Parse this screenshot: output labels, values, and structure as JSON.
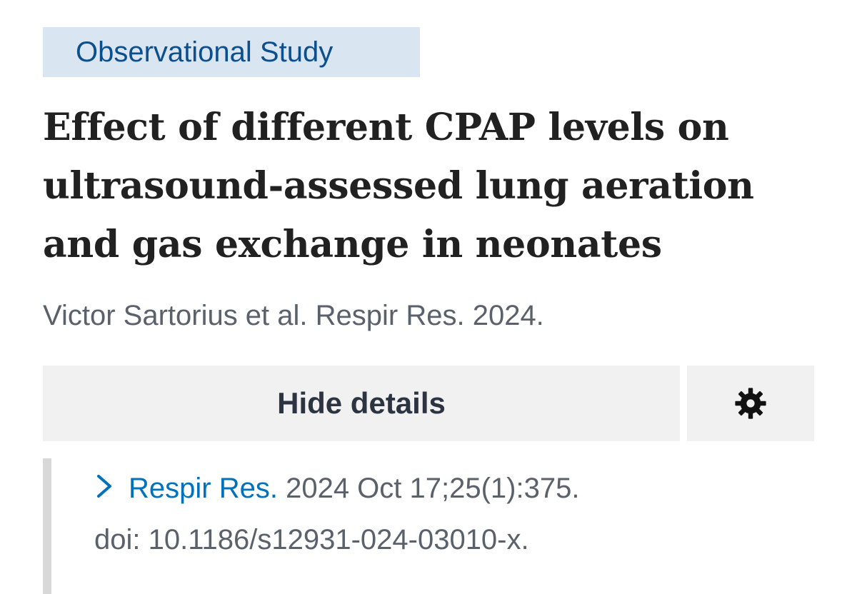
{
  "article": {
    "type_badge": "Observational Study",
    "title": "Effect of different CPAP levels on ultrasound-assessed lung aeration and gas exchange in neonates",
    "authors_line": "Victor Sartorius et al. Respir Res. 2024."
  },
  "controls": {
    "details_label": "Hide details",
    "settings_icon": "gear-icon"
  },
  "citation": {
    "journal": "Respir Res.",
    "issue": "2024 Oct 17;25(1):375.",
    "doi": "doi: 10.1186/s12931-024-03010-x."
  },
  "colors": {
    "badge_bg": "#dae5f2",
    "badge_text": "#0b4f8c",
    "link": "#0071bc",
    "muted_text": "#5b616b",
    "button_bg": "#f1f1f1"
  }
}
